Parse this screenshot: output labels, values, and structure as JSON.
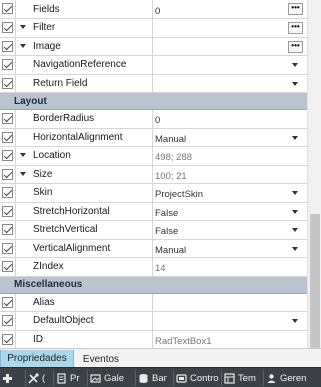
{
  "properties": [
    {
      "name": "Fields",
      "value": "0",
      "checked": true,
      "expandable": false,
      "editor": "ellipsis"
    },
    {
      "name": "Filter",
      "value": "",
      "checked": true,
      "expandable": true,
      "editor": "ellipsis"
    },
    {
      "name": "Image",
      "value": "",
      "checked": true,
      "expandable": true,
      "editor": "ellipsis"
    },
    {
      "name": "NavigationReference",
      "value": "",
      "checked": true,
      "expandable": false,
      "editor": "dropdown"
    },
    {
      "name": "Return Field",
      "value": "",
      "checked": true,
      "expandable": false,
      "editor": "dropdown"
    }
  ],
  "category_layout": "Layout",
  "layout_properties": [
    {
      "name": "BorderRadius",
      "value": "0",
      "checked": true,
      "expandable": false,
      "editor": "none",
      "muted": false
    },
    {
      "name": "HorizontalAlignment",
      "value": "Manual",
      "checked": true,
      "expandable": false,
      "editor": "dropdown",
      "muted": false
    },
    {
      "name": "Location",
      "value": "498; 288",
      "checked": true,
      "expandable": true,
      "editor": "none",
      "muted": true
    },
    {
      "name": "Size",
      "value": "100; 21",
      "checked": true,
      "expandable": true,
      "editor": "none",
      "muted": true
    },
    {
      "name": "Skin",
      "value": "ProjectSkin",
      "checked": true,
      "expandable": false,
      "editor": "dropdown",
      "muted": false
    },
    {
      "name": "StretchHorizontal",
      "value": "False",
      "checked": true,
      "expandable": false,
      "editor": "dropdown",
      "muted": false
    },
    {
      "name": "StretchVertical",
      "value": "False",
      "checked": true,
      "expandable": false,
      "editor": "dropdown",
      "muted": false
    },
    {
      "name": "VerticalAlignment",
      "value": "Manual",
      "checked": true,
      "expandable": false,
      "editor": "dropdown",
      "muted": false
    },
    {
      "name": "ZIndex",
      "value": "14",
      "checked": true,
      "expandable": false,
      "editor": "none",
      "muted": true
    }
  ],
  "category_misc": "Miscellaneous",
  "misc_properties": [
    {
      "name": "Alias",
      "value": "",
      "checked": true,
      "expandable": false,
      "editor": "none",
      "muted": false
    },
    {
      "name": "DefaultObject",
      "value": "",
      "checked": true,
      "expandable": false,
      "editor": "dropdown",
      "muted": false
    },
    {
      "name": "ID",
      "value": "RadTextBox1",
      "checked": true,
      "expandable": false,
      "editor": "none",
      "muted": true
    }
  ],
  "tabs": [
    {
      "label": "Propriedades",
      "active": true
    },
    {
      "label": "Eventos",
      "active": false
    }
  ],
  "taskbar": [
    {
      "icon": "add-icon",
      "label": ""
    },
    {
      "icon": "tools-icon",
      "label": "("
    },
    {
      "icon": "page-icon",
      "label": "Pr"
    },
    {
      "icon": "gallery-icon",
      "label": "Gale"
    },
    {
      "icon": "database-icon",
      "label": "Bar"
    },
    {
      "icon": "controls-icon",
      "label": "Contro"
    },
    {
      "icon": "template-icon",
      "label": "Tem"
    },
    {
      "icon": "manager-icon",
      "label": "Geren"
    }
  ]
}
